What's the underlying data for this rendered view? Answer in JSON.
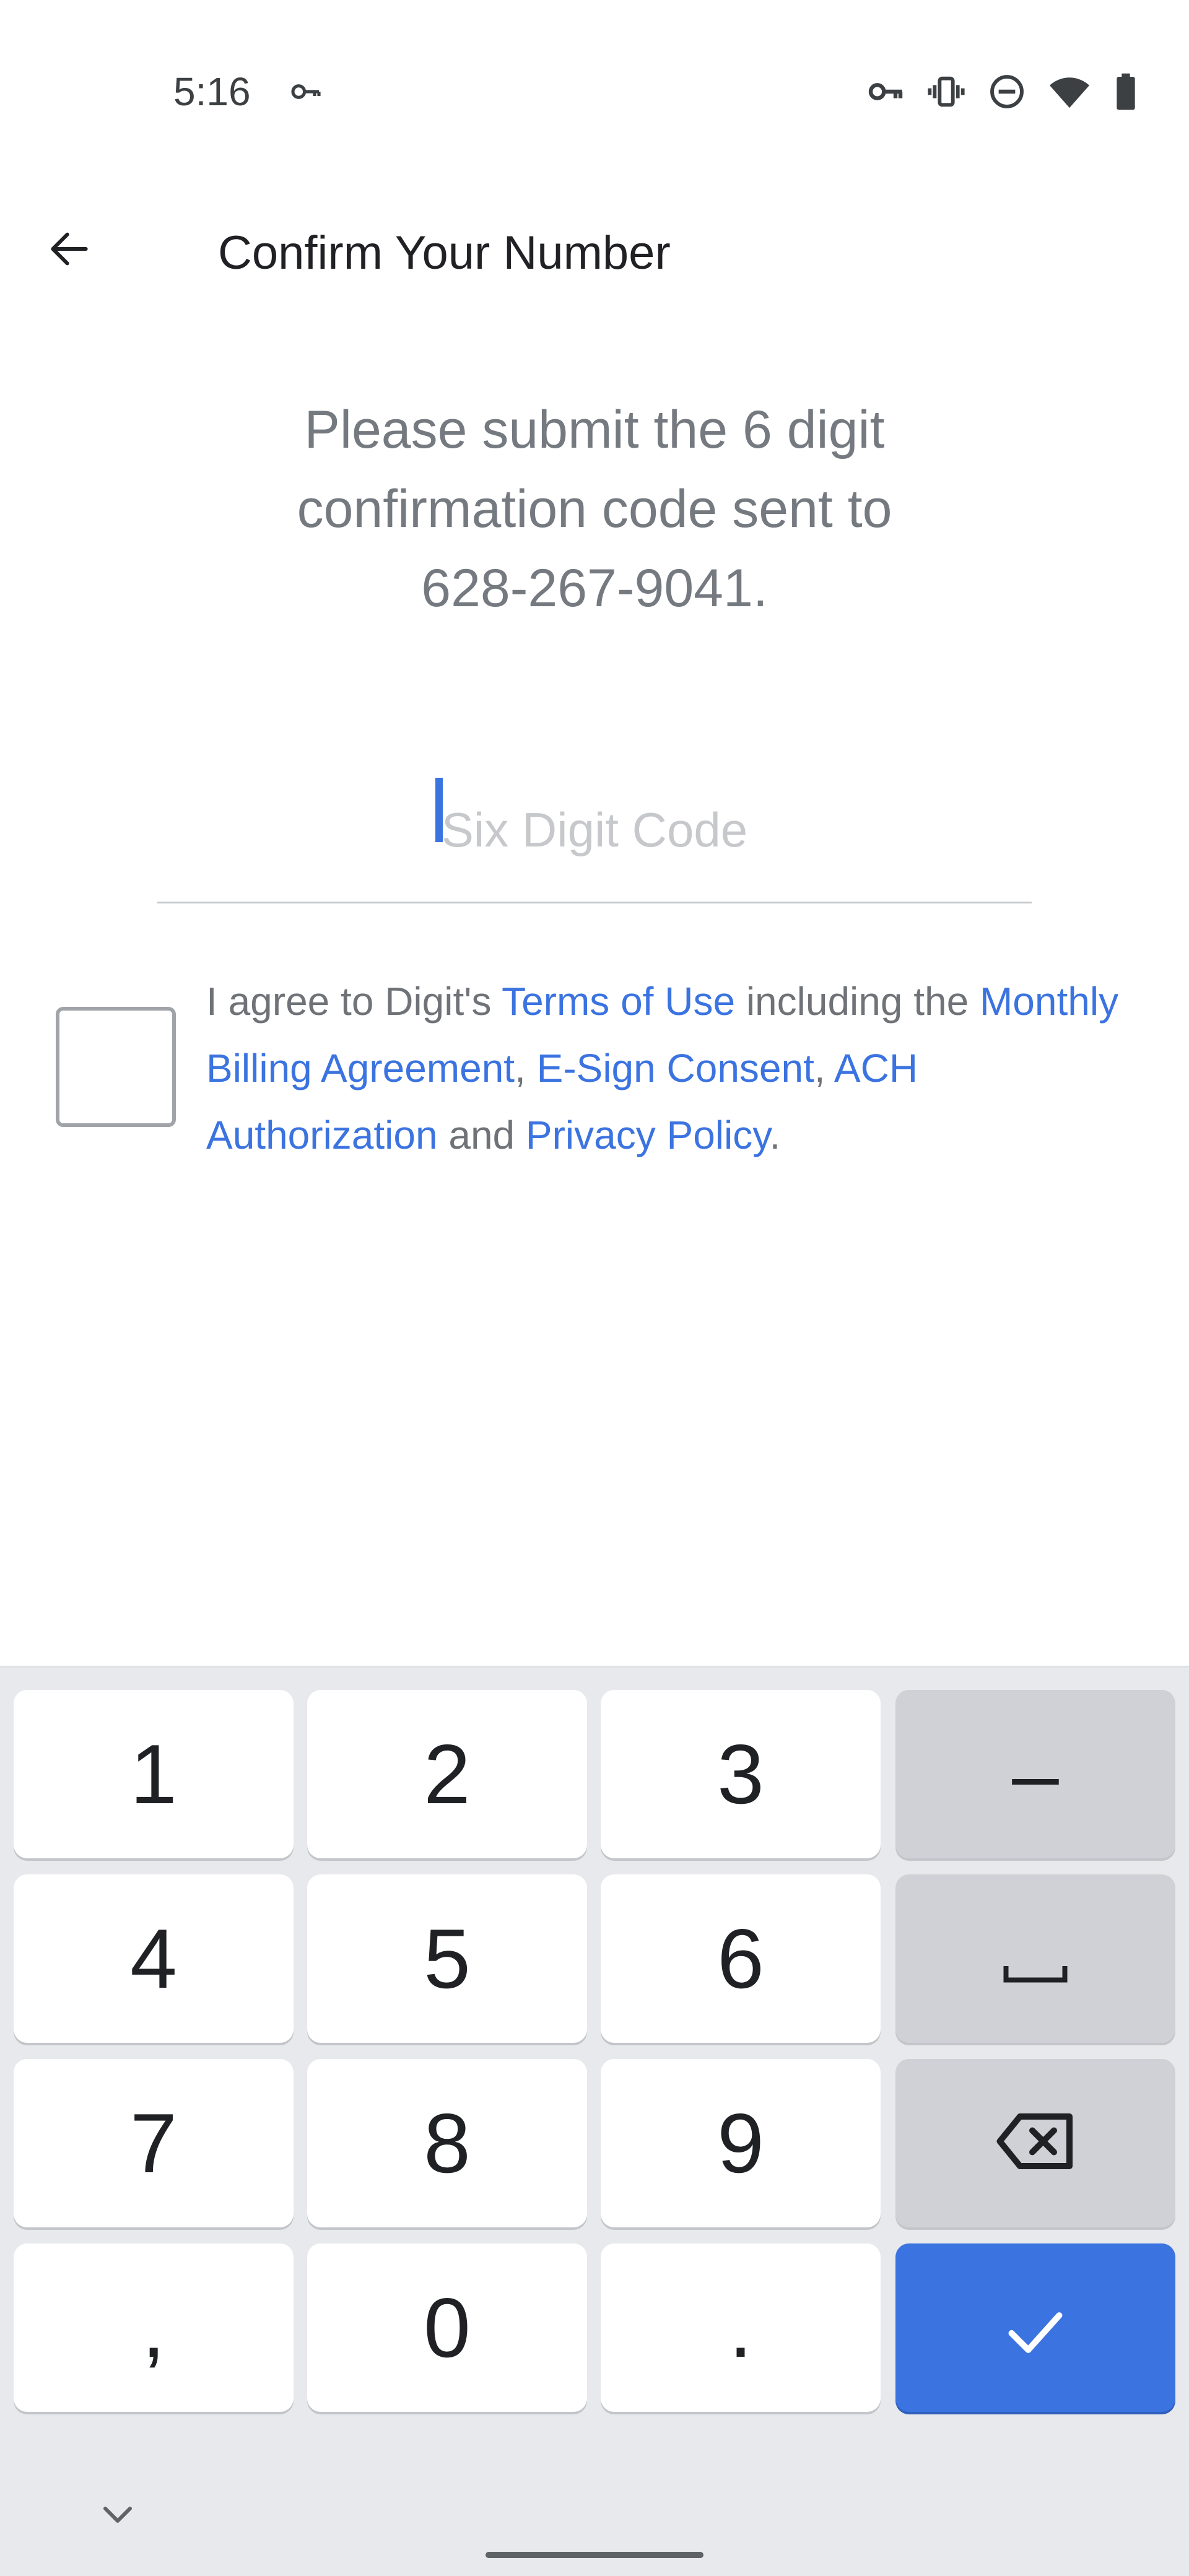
{
  "status_bar": {
    "time": "5:16",
    "left_icons": [
      "key-icon"
    ],
    "right_icons": [
      "vpn-key-icon",
      "vibrate-icon",
      "do-not-disturb-icon",
      "wifi-icon",
      "battery-icon"
    ]
  },
  "app_bar": {
    "back_icon": "arrow-left-icon",
    "title": "Confirm Your Number"
  },
  "instruction": {
    "line1": "Please submit the 6 digit",
    "line2": "confirmation code sent to",
    "line3": "628-267-9041."
  },
  "code_input": {
    "value": "",
    "placeholder": "Six Digit Code"
  },
  "agreement": {
    "checked": false,
    "prefix": "I agree to Digit's ",
    "terms_link": "Terms of Use",
    "mid1": " including the ",
    "billing_link": "Monthly Billing Agreement",
    "sep1": ", ",
    "esign_link": "E-Sign Consent",
    "sep2": ", ",
    "ach_link": "ACH Authorization",
    "mid2": " and ",
    "privacy_link": "Privacy Policy",
    "suffix": "."
  },
  "keyboard": {
    "keys": {
      "k1": "1",
      "k2": "2",
      "k3": "3",
      "dash": "–",
      "k4": "4",
      "k5": "5",
      "k6": "6",
      "k7": "7",
      "k8": "8",
      "k9": "9",
      "comma": ",",
      "k0": "0",
      "period": "."
    },
    "icons": [
      "space-icon",
      "backspace-icon",
      "checkmark-icon",
      "chevron-down-icon"
    ]
  },
  "colors": {
    "accent": "#3b73e0",
    "text_muted": "#757a80",
    "keyboard_bg": "#e8e9ed",
    "function_key": "#cfd1d6"
  }
}
